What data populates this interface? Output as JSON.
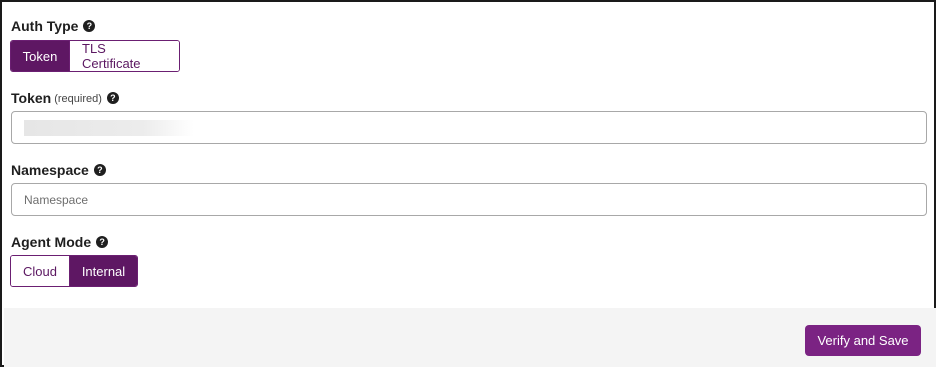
{
  "auth_type": {
    "label": "Auth Type",
    "help_icon": "question-circle-icon",
    "options": [
      "Token",
      "TLS Certificate"
    ],
    "selected": "Token"
  },
  "token": {
    "label": "Token",
    "required_note": "(required)",
    "help_icon": "question-circle-icon",
    "value": ""
  },
  "namespace": {
    "label": "Namespace",
    "help_icon": "question-circle-icon",
    "placeholder": "Namespace",
    "value": ""
  },
  "agent_mode": {
    "label": "Agent Mode",
    "help_icon": "question-circle-icon",
    "options": [
      "Cloud",
      "Internal"
    ],
    "selected": "Internal"
  },
  "footer": {
    "submit_label": "Verify and Save"
  },
  "colors": {
    "accent": "#5e1763",
    "button": "#7b2383",
    "footer_bg": "#f4f4f4"
  }
}
